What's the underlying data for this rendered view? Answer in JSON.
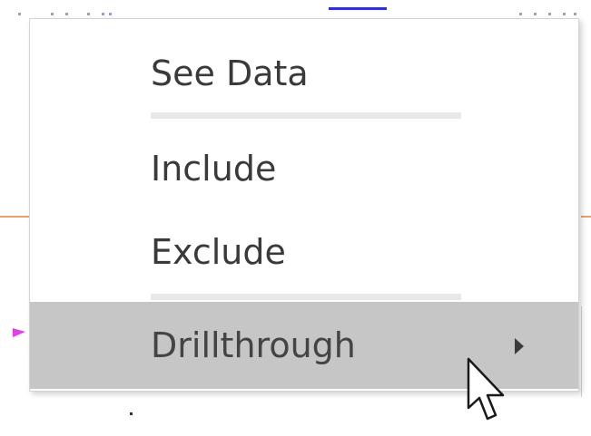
{
  "context_menu": {
    "items": [
      {
        "label": "See Data"
      },
      {
        "label": "Include"
      },
      {
        "label": "Exclude"
      },
      {
        "label": "Drillthrough",
        "has_submenu": true,
        "highlighted": true
      }
    ]
  },
  "colors": {
    "highlight": "#c6c6c6",
    "separator": "#e8e8e8",
    "text": "#3a3a3a"
  },
  "icons": {
    "submenu": "chevron-right-icon",
    "pointer": "mouse-pointer-icon"
  }
}
